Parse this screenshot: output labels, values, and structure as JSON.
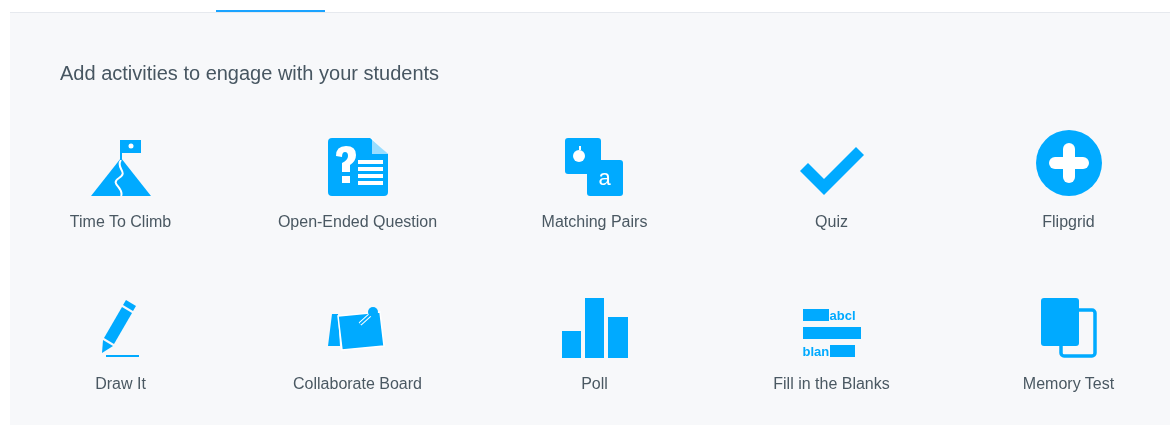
{
  "tabs": [
    {
      "selected": true
    }
  ],
  "heading": "Add activities to engage with your students",
  "activities": [
    {
      "kind": "climb",
      "label": "Time To Climb"
    },
    {
      "kind": "question",
      "label": "Open-Ended Question"
    },
    {
      "kind": "pairs",
      "label": "Matching Pairs",
      "icon_texts": [
        "a"
      ]
    },
    {
      "kind": "quiz",
      "label": "Quiz"
    },
    {
      "kind": "plus",
      "label": "Flipgrid"
    },
    {
      "kind": "draw",
      "label": "Draw It"
    },
    {
      "kind": "board",
      "label": "Collaborate Board"
    },
    {
      "kind": "poll",
      "label": "Poll"
    },
    {
      "kind": "blanks",
      "label": "Fill in the Blanks",
      "icon_texts": [
        "abcl",
        "blan"
      ]
    },
    {
      "kind": "memory",
      "label": "Memory Test"
    }
  ]
}
